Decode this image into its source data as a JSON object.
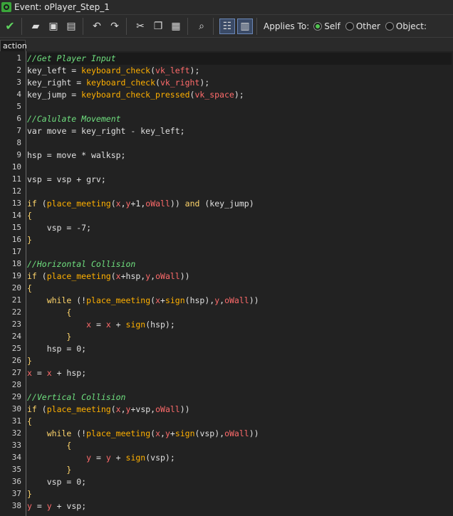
{
  "window": {
    "title": "Event: oPlayer_Step_1"
  },
  "toolbar": {
    "applies_label": "Applies To:",
    "options": [
      {
        "label": "Self",
        "checked": true
      },
      {
        "label": "Other",
        "checked": false
      },
      {
        "label": "Object:",
        "checked": false
      }
    ]
  },
  "tab": {
    "label": "action"
  },
  "colors": {
    "comment": "#6fe07f",
    "function": "#ffb000",
    "constant": "#ff6b6b",
    "keyword": "#ffd56b",
    "plain": "#e0e0e0",
    "linenum": "#cfcfcf"
  },
  "code": {
    "lines": [
      [
        {
          "t": "//Get Player Input",
          "c": "comment"
        }
      ],
      [
        {
          "t": "key_left = ",
          "c": "plain"
        },
        {
          "t": "keyboard_check",
          "c": "function"
        },
        {
          "t": "(",
          "c": "plain"
        },
        {
          "t": "vk_left",
          "c": "constant"
        },
        {
          "t": ");",
          "c": "plain"
        }
      ],
      [
        {
          "t": "key_right = ",
          "c": "plain"
        },
        {
          "t": "keyboard_check",
          "c": "function"
        },
        {
          "t": "(",
          "c": "plain"
        },
        {
          "t": "vk_right",
          "c": "constant"
        },
        {
          "t": ");",
          "c": "plain"
        }
      ],
      [
        {
          "t": "key_jump = ",
          "c": "plain"
        },
        {
          "t": "keyboard_check_pressed",
          "c": "function"
        },
        {
          "t": "(",
          "c": "plain"
        },
        {
          "t": "vk_space",
          "c": "constant"
        },
        {
          "t": ");",
          "c": "plain"
        }
      ],
      [],
      [
        {
          "t": "//Calulate Movement",
          "c": "comment"
        }
      ],
      [
        {
          "t": "var move = key_right - key_left;",
          "c": "plain"
        }
      ],
      [],
      [
        {
          "t": "hsp = move * walksp;",
          "c": "plain"
        }
      ],
      [],
      [
        {
          "t": "vsp = vsp + grv;",
          "c": "plain"
        }
      ],
      [],
      [
        {
          "t": "if",
          "c": "keyword"
        },
        {
          "t": " (",
          "c": "plain"
        },
        {
          "t": "place_meeting",
          "c": "function"
        },
        {
          "t": "(",
          "c": "plain"
        },
        {
          "t": "x",
          "c": "constant"
        },
        {
          "t": ",",
          "c": "plain"
        },
        {
          "t": "y",
          "c": "constant"
        },
        {
          "t": "+1,",
          "c": "plain"
        },
        {
          "t": "oWall",
          "c": "constant"
        },
        {
          "t": ")) ",
          "c": "plain"
        },
        {
          "t": "and",
          "c": "keyword"
        },
        {
          "t": " (key_jump)",
          "c": "plain"
        }
      ],
      [
        {
          "t": "{",
          "c": "keyword"
        }
      ],
      [
        {
          "t": "    vsp = -7;",
          "c": "plain"
        }
      ],
      [
        {
          "t": "}",
          "c": "keyword"
        }
      ],
      [],
      [
        {
          "t": "//Horizontal Collision",
          "c": "comment"
        }
      ],
      [
        {
          "t": "if",
          "c": "keyword"
        },
        {
          "t": " (",
          "c": "plain"
        },
        {
          "t": "place_meeting",
          "c": "function"
        },
        {
          "t": "(",
          "c": "plain"
        },
        {
          "t": "x",
          "c": "constant"
        },
        {
          "t": "+hsp,",
          "c": "plain"
        },
        {
          "t": "y",
          "c": "constant"
        },
        {
          "t": ",",
          "c": "plain"
        },
        {
          "t": "oWall",
          "c": "constant"
        },
        {
          "t": "))",
          "c": "plain"
        }
      ],
      [
        {
          "t": "{",
          "c": "keyword"
        }
      ],
      [
        {
          "t": "    ",
          "c": "plain"
        },
        {
          "t": "while",
          "c": "keyword"
        },
        {
          "t": " (!",
          "c": "plain"
        },
        {
          "t": "place_meeting",
          "c": "function"
        },
        {
          "t": "(",
          "c": "plain"
        },
        {
          "t": "x",
          "c": "constant"
        },
        {
          "t": "+",
          "c": "plain"
        },
        {
          "t": "sign",
          "c": "function"
        },
        {
          "t": "(hsp),",
          "c": "plain"
        },
        {
          "t": "y",
          "c": "constant"
        },
        {
          "t": ",",
          "c": "plain"
        },
        {
          "t": "oWall",
          "c": "constant"
        },
        {
          "t": "))",
          "c": "plain"
        }
      ],
      [
        {
          "t": "        {",
          "c": "keyword"
        }
      ],
      [
        {
          "t": "            ",
          "c": "plain"
        },
        {
          "t": "x",
          "c": "constant"
        },
        {
          "t": " = ",
          "c": "plain"
        },
        {
          "t": "x",
          "c": "constant"
        },
        {
          "t": " + ",
          "c": "plain"
        },
        {
          "t": "sign",
          "c": "function"
        },
        {
          "t": "(hsp);",
          "c": "plain"
        }
      ],
      [
        {
          "t": "        }",
          "c": "keyword"
        }
      ],
      [
        {
          "t": "    hsp = 0;",
          "c": "plain"
        }
      ],
      [
        {
          "t": "}",
          "c": "keyword"
        }
      ],
      [
        {
          "t": "x",
          "c": "constant"
        },
        {
          "t": " = ",
          "c": "plain"
        },
        {
          "t": "x",
          "c": "constant"
        },
        {
          "t": " + hsp;",
          "c": "plain"
        }
      ],
      [],
      [
        {
          "t": "//Vertical Collision",
          "c": "comment"
        }
      ],
      [
        {
          "t": "if",
          "c": "keyword"
        },
        {
          "t": " (",
          "c": "plain"
        },
        {
          "t": "place_meeting",
          "c": "function"
        },
        {
          "t": "(",
          "c": "plain"
        },
        {
          "t": "x",
          "c": "constant"
        },
        {
          "t": ",",
          "c": "plain"
        },
        {
          "t": "y",
          "c": "constant"
        },
        {
          "t": "+vsp,",
          "c": "plain"
        },
        {
          "t": "oWall",
          "c": "constant"
        },
        {
          "t": "))",
          "c": "plain"
        }
      ],
      [
        {
          "t": "{",
          "c": "keyword"
        }
      ],
      [
        {
          "t": "    ",
          "c": "plain"
        },
        {
          "t": "while",
          "c": "keyword"
        },
        {
          "t": " (!",
          "c": "plain"
        },
        {
          "t": "place_meeting",
          "c": "function"
        },
        {
          "t": "(",
          "c": "plain"
        },
        {
          "t": "x",
          "c": "constant"
        },
        {
          "t": ",",
          "c": "plain"
        },
        {
          "t": "y",
          "c": "constant"
        },
        {
          "t": "+",
          "c": "plain"
        },
        {
          "t": "sign",
          "c": "function"
        },
        {
          "t": "(vsp),",
          "c": "plain"
        },
        {
          "t": "oWall",
          "c": "constant"
        },
        {
          "t": "))",
          "c": "plain"
        }
      ],
      [
        {
          "t": "        {",
          "c": "keyword"
        }
      ],
      [
        {
          "t": "            ",
          "c": "plain"
        },
        {
          "t": "y",
          "c": "constant"
        },
        {
          "t": " = ",
          "c": "plain"
        },
        {
          "t": "y",
          "c": "constant"
        },
        {
          "t": " + ",
          "c": "plain"
        },
        {
          "t": "sign",
          "c": "function"
        },
        {
          "t": "(vsp);",
          "c": "plain"
        }
      ],
      [
        {
          "t": "        }",
          "c": "keyword"
        }
      ],
      [
        {
          "t": "    vsp = 0;",
          "c": "plain"
        }
      ],
      [
        {
          "t": "}",
          "c": "keyword"
        }
      ],
      [
        {
          "t": "y",
          "c": "constant"
        },
        {
          "t": " = ",
          "c": "plain"
        },
        {
          "t": "y",
          "c": "constant"
        },
        {
          "t": " + vsp;",
          "c": "plain"
        }
      ]
    ]
  }
}
